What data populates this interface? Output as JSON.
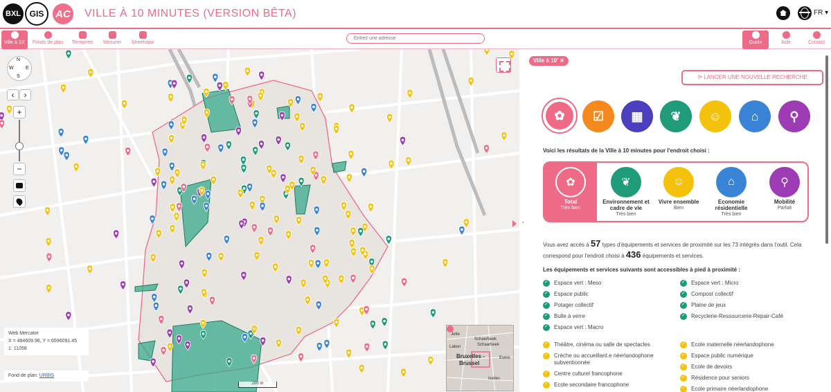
{
  "header": {
    "logos": {
      "bxl": "BXL",
      "gis": "GIS",
      "ac": "AC"
    },
    "title": "VILLE À 10 MINUTES (VERSION BÊTA)",
    "lang": "FR ▾"
  },
  "toolbar": {
    "items": [
      {
        "label": "Ville à 10'"
      },
      {
        "label": "Fonds de plan"
      },
      {
        "label": "Territoires"
      },
      {
        "label": "Mesurer"
      },
      {
        "label": "Streetview"
      }
    ],
    "search_placeholder": "Entrez une adresse",
    "right": [
      {
        "label": "Guide"
      },
      {
        "label": "Aide"
      },
      {
        "label": "Contact"
      }
    ]
  },
  "map": {
    "compass": {
      "n": "N",
      "s": "S",
      "e": "E",
      "w": "W"
    },
    "zoom_in": "+",
    "zoom_out": "−",
    "nav_prev": "‹",
    "nav_next": "›",
    "projection": "Web Mercator",
    "coords": "X = 484609.96, Y = 6596091.45",
    "scale_ratio": "1: 11268",
    "basemap_label": "Fond de plan:",
    "basemap_link": "URBIS",
    "scale_bar": "200 m",
    "minimap_labels": {
      "a": "Jette",
      "b": "Schaerbeek",
      "c": "Schaarbeek",
      "d": "Bruxelles -",
      "e": "Brussel",
      "f": "Evere",
      "g": "Ixelles",
      "h": "Laken"
    },
    "colors": {
      "accent": "#ee6b88",
      "park": "#3aa98c",
      "zone": "#e8e5e1"
    }
  },
  "panel": {
    "chip": "Ville à 10'  ✕",
    "new_search": "⟳  LANCER UNE NOUVELLE RECHERCHE",
    "categories": [
      {
        "name": "total",
        "color": "#ee6b88",
        "glyph": "✿"
      },
      {
        "name": "services",
        "color": "#f5891e",
        "glyph": "☑"
      },
      {
        "name": "ville",
        "color": "#4b3fc0",
        "glyph": "▦"
      },
      {
        "name": "environnement",
        "color": "#1f9b7a",
        "glyph": "❦"
      },
      {
        "name": "vivre",
        "color": "#f4c20d",
        "glyph": "☺"
      },
      {
        "name": "economie",
        "color": "#3a84d8",
        "glyph": "⌂"
      },
      {
        "name": "mobilite",
        "color": "#9c3bb3",
        "glyph": "⚲"
      }
    ],
    "results_heading": "Voici les résultats de la Ville à 10 minutes pour l'endroit choisi :",
    "scores": [
      {
        "name": "Total",
        "rating": "Très bien",
        "color": "#ee6b88",
        "glyph": "✿"
      },
      {
        "name": "Environnement et cadre de vie",
        "rating": "Très bien",
        "color": "#1f9b7a",
        "glyph": "❦"
      },
      {
        "name": "Vivre ensemble",
        "rating": "Bien",
        "color": "#f4c20d",
        "glyph": "☺"
      },
      {
        "name": "Economie résidentielle",
        "rating": "Très bien",
        "color": "#3a84d8",
        "glyph": "⌂"
      },
      {
        "name": "Mobilité",
        "rating": "Parfait",
        "color": "#9c3bb3",
        "glyph": "⚲"
      }
    ],
    "summary": {
      "p1": "Vous avez accès à",
      "n1": "57",
      "p2": "types d'équipements et services de proximité sur les 73 intégrés dans l'outil. Cela correspond pour l'endroit choisi à",
      "n2": "436",
      "p3": "équipements et services."
    },
    "walk_heading": "Les équipements et services suivants sont accessibles à pied à proximité :",
    "green_col1": [
      "Espace vert : Meso",
      "Espace public",
      "Potager collectif",
      "Bulle à verre",
      "Espace vert : Macro"
    ],
    "green_col2": [
      "Espace vert : Micro",
      "Compost collectif",
      "Plaine de jeux",
      "Recyclerie-Ressourcerie-Repair-Café"
    ],
    "yellow_col1": [
      "Théâtre, cinéma ou salle de spectacles",
      "Crèche ou accueillant.e néerlandophone subventionnée",
      "Centre culturel francophone",
      "Ecole secondaire francophone"
    ],
    "yellow_col2": [
      "Ecole maternelle néerlandophone",
      "Espace public numérique",
      "Ecole de devoirs",
      "Résidence pour seniors",
      "Ecole primaire néerlandophone"
    ]
  }
}
